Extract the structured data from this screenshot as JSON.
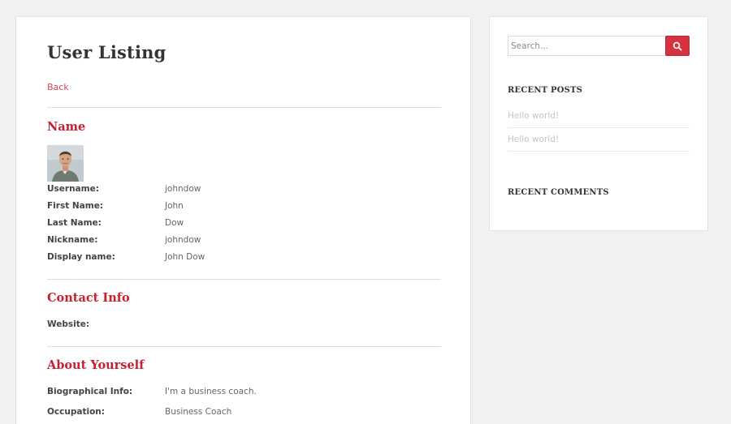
{
  "main": {
    "title": "User Listing",
    "back_label": "Back",
    "sections": {
      "name": {
        "heading": "Name",
        "fields": [
          {
            "label": "Username:",
            "value": "johndow"
          },
          {
            "label": "First Name:",
            "value": "John"
          },
          {
            "label": "Last Name:",
            "value": "Dow"
          },
          {
            "label": "Nickname:",
            "value": "johndow"
          },
          {
            "label": "Display name:",
            "value": "John Dow"
          }
        ]
      },
      "contact": {
        "heading": "Contact Info",
        "fields": [
          {
            "label": "Website:",
            "value": ""
          }
        ]
      },
      "about": {
        "heading": "About Yourself",
        "fields": [
          {
            "label": "Biographical Info:",
            "value": "I'm a business coach."
          },
          {
            "label": "Occupation:",
            "value": "Business Coach"
          }
        ]
      }
    }
  },
  "sidebar": {
    "search": {
      "placeholder": "Search...",
      "icon": "search-icon"
    },
    "recent_posts": {
      "title": "RECENT POSTS",
      "items": [
        "Hello world!",
        "Hello world!"
      ]
    },
    "recent_comments": {
      "title": "RECENT COMMENTS"
    }
  },
  "colors": {
    "accent": "#c8202f",
    "link": "#d84a55",
    "button": "#d5333f",
    "background": "#f1f1f1"
  }
}
